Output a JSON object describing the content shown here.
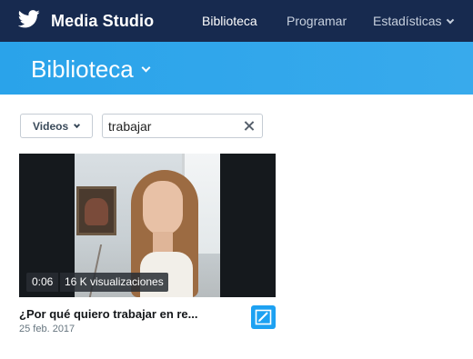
{
  "app": {
    "title": "Media Studio",
    "logo_icon": "twitter-bird-icon"
  },
  "nav": {
    "items": [
      {
        "label": "Biblioteca",
        "active": true
      },
      {
        "label": "Programar",
        "active": false
      },
      {
        "label": "Estadísticas",
        "active": false
      }
    ]
  },
  "header": {
    "title": "Biblioteca"
  },
  "filters": {
    "type_label": "Videos",
    "search_value": "trabajar"
  },
  "videos": [
    {
      "duration": "0:06",
      "views": "16 K visualizaciones",
      "title": "¿Por qué quiero trabajar en re...",
      "date": "25 feb. 2017"
    }
  ],
  "colors": {
    "topbar": "#172a4f",
    "header": "#2aa3ea",
    "accent": "#1da1f2"
  }
}
